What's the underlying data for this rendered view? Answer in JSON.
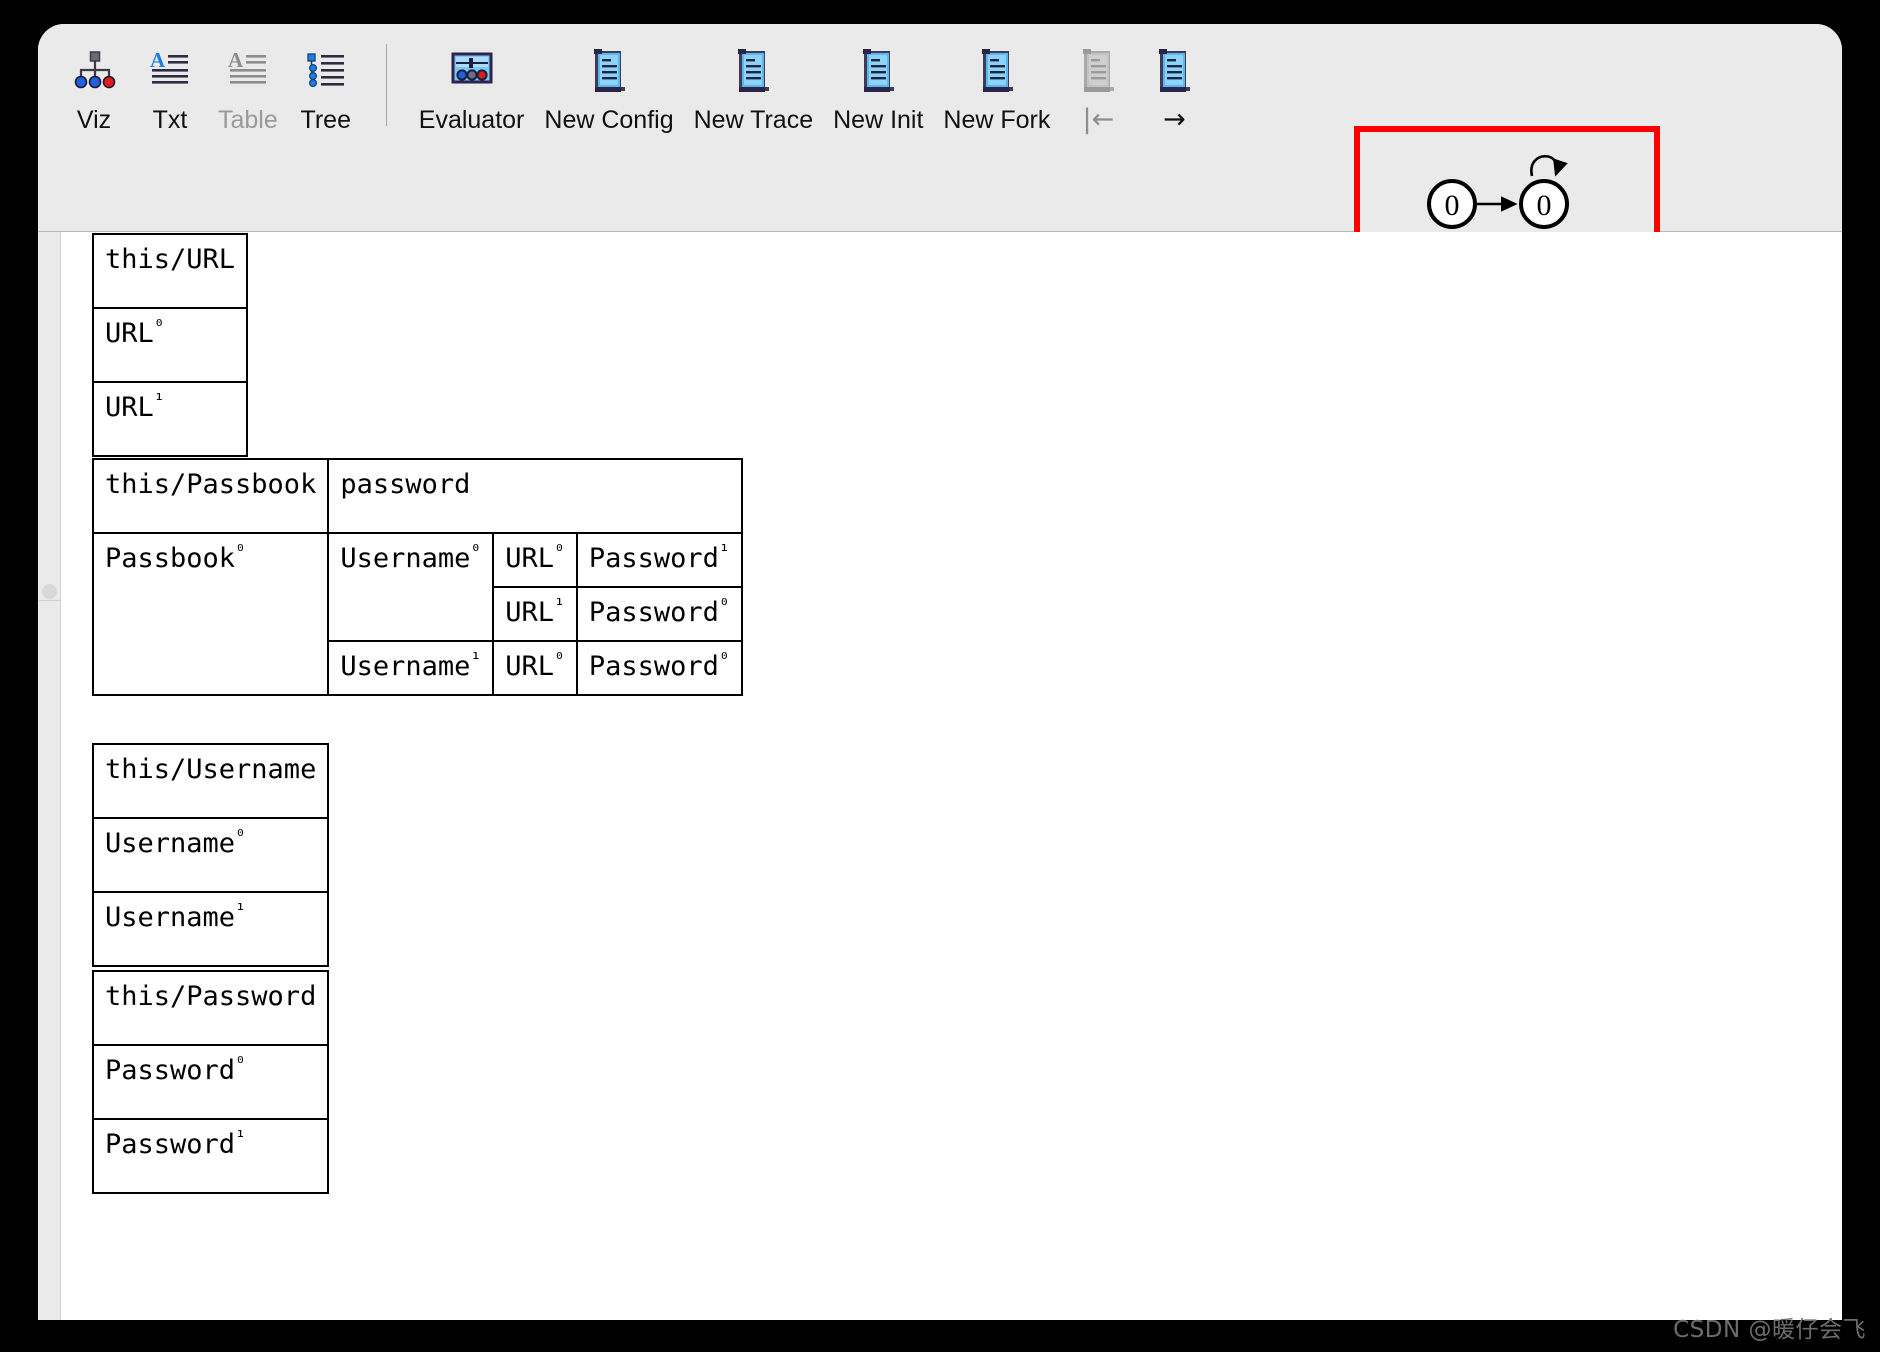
{
  "toolbar": {
    "items": [
      {
        "id": "viz",
        "label": "Viz",
        "icon": "tree-graph-icon",
        "disabled": false,
        "kind": "icon"
      },
      {
        "id": "txt",
        "label": "Txt",
        "icon": "text-lines-icon",
        "disabled": false,
        "kind": "icon"
      },
      {
        "id": "table",
        "label": "Table",
        "icon": "text-lines-icon",
        "disabled": true,
        "kind": "icon"
      },
      {
        "id": "tree",
        "label": "Tree",
        "icon": "tree-list-icon",
        "disabled": false,
        "kind": "icon"
      },
      {
        "id": "evaluator",
        "label": "Evaluator",
        "icon": "evaluator-icon",
        "disabled": false,
        "kind": "icon"
      },
      {
        "id": "new-config",
        "label": "New Config",
        "icon": "scroll-icon",
        "disabled": false,
        "kind": "icon"
      },
      {
        "id": "new-trace",
        "label": "New Trace",
        "icon": "scroll-icon",
        "disabled": false,
        "kind": "icon"
      },
      {
        "id": "new-init",
        "label": "New Init",
        "icon": "scroll-icon",
        "disabled": false,
        "kind": "icon"
      },
      {
        "id": "new-fork",
        "label": "New Fork",
        "icon": "scroll-icon",
        "disabled": false,
        "kind": "icon"
      },
      {
        "id": "prev-state",
        "label": "|←",
        "icon": "scroll-gray-icon",
        "disabled": true,
        "kind": "arrow"
      },
      {
        "id": "next-state",
        "label": "→",
        "icon": "scroll-icon",
        "disabled": false,
        "kind": "arrow"
      }
    ],
    "separator_after": "tree"
  },
  "graph_preview": {
    "highlight_color": "#ff0000",
    "nodes": [
      {
        "id": "n0",
        "label": "0"
      },
      {
        "id": "n1",
        "label": "0"
      }
    ],
    "edges": [
      {
        "from": "n0",
        "to": "n1",
        "kind": "arrow"
      },
      {
        "from": "n1",
        "to": "n1",
        "kind": "self-loop"
      }
    ]
  },
  "tables": {
    "url": {
      "header": "this/URL",
      "rows": [
        {
          "base": "URL",
          "sup": "⁰"
        },
        {
          "base": "URL",
          "sup": "¹"
        }
      ]
    },
    "passbook": {
      "header_left": "this/Passbook",
      "header_right": "password",
      "atom": {
        "base": "Passbook",
        "sup": "⁰"
      },
      "entries": [
        {
          "username": {
            "base": "Username",
            "sup": "⁰"
          },
          "pairs": [
            {
              "url": {
                "base": "URL",
                "sup": "⁰"
              },
              "password": {
                "base": "Password",
                "sup": "¹"
              }
            },
            {
              "url": {
                "base": "URL",
                "sup": "¹"
              },
              "password": {
                "base": "Password",
                "sup": "⁰"
              }
            }
          ]
        },
        {
          "username": {
            "base": "Username",
            "sup": "¹"
          },
          "pairs": [
            {
              "url": {
                "base": "URL",
                "sup": "⁰"
              },
              "password": {
                "base": "Password",
                "sup": "⁰"
              }
            }
          ]
        }
      ]
    },
    "username": {
      "header": "this/Username",
      "rows": [
        {
          "base": "Username",
          "sup": "⁰"
        },
        {
          "base": "Username",
          "sup": "¹"
        }
      ]
    },
    "password": {
      "header": "this/Password",
      "rows": [
        {
          "base": "Password",
          "sup": "⁰"
        },
        {
          "base": "Password",
          "sup": "¹"
        }
      ]
    }
  },
  "watermark": "CSDN @暖仔会飞"
}
